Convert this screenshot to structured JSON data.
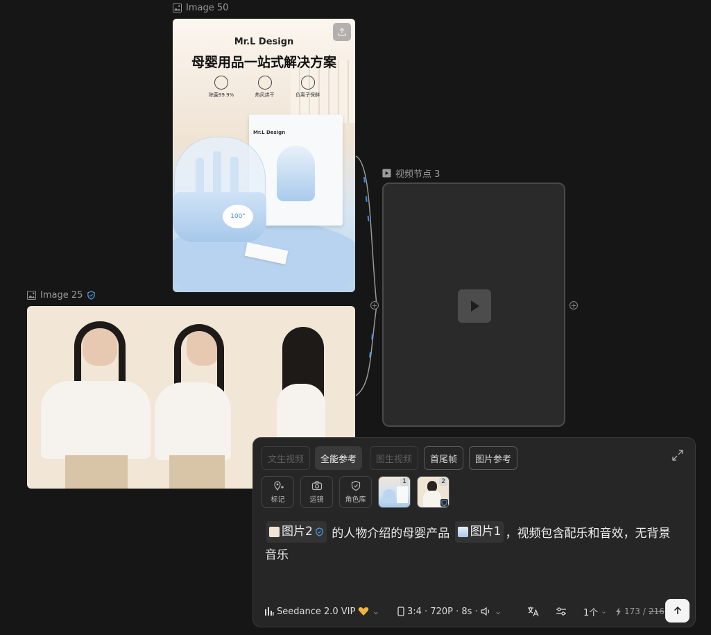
{
  "nodes": {
    "product": {
      "label": "Image 50",
      "brand": "Mr.L Design",
      "headline": "母婴用品一站式解决方案",
      "features": [
        "除菌99.9%",
        "热风烘干",
        "负离子保鲜"
      ],
      "box_brand": "Mr.L Design",
      "display": "100°"
    },
    "portrait": {
      "label": "Image 25"
    },
    "video": {
      "label": "视频节点 3"
    }
  },
  "panel": {
    "mode_tabs": [
      {
        "label": "文生视频",
        "state": "disabled"
      },
      {
        "label": "全能参考",
        "state": "active"
      },
      {
        "label": "图生视频",
        "state": "disabled"
      },
      {
        "label": "首尾帧",
        "state": "normal"
      },
      {
        "label": "图片参考",
        "state": "normal"
      }
    ],
    "tools": [
      {
        "label": "标记",
        "icon": "pin-plus-icon"
      },
      {
        "label": "运镜",
        "icon": "camera-icon"
      },
      {
        "label": "角色库",
        "icon": "shield-icon"
      }
    ],
    "thumbs": [
      {
        "badge": "1"
      },
      {
        "badge": "2"
      }
    ],
    "prompt": {
      "chip1": "图片2",
      "text1": "的人物介绍的母婴产品",
      "chip2": "图片1",
      "text2": "，视频包含配乐和音效，无背景音乐"
    },
    "model": "Seedance 2.0 VIP",
    "settings": "3:4 · 720P · 8s ·",
    "count": "1个",
    "credits_current": "173",
    "credits_sep": " / ",
    "credits_original": "216"
  },
  "colors": {
    "accent_blue": "#3b8fe0",
    "vip_gold": "#f2b33d",
    "verified": "#4aa3e8"
  }
}
